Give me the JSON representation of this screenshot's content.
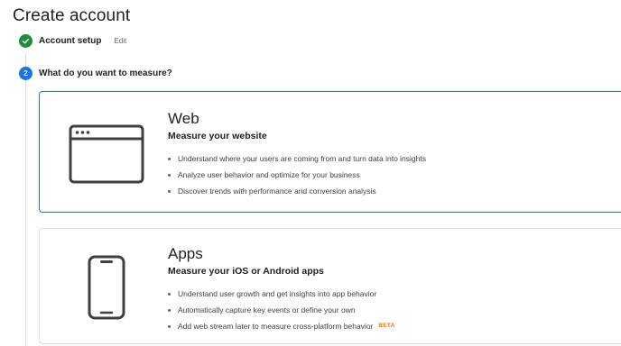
{
  "page": {
    "title": "Create account"
  },
  "stepper": {
    "steps": [
      {
        "label": "Account setup",
        "action": "Edit",
        "status": "completed",
        "icon": "check-icon"
      },
      {
        "number": "2",
        "label": "What do you want to measure?",
        "status": "active"
      }
    ]
  },
  "options": [
    {
      "title": "Web",
      "subtitle": "Measure your website",
      "icon": "browser-window-icon",
      "selected": true,
      "bullets": [
        "Understand where your users are coming from and turn data into insights",
        "Analyze user behavior and optimize for your business",
        "Discover trends with performance and conversion analysis"
      ]
    },
    {
      "title": "Apps",
      "subtitle": "Measure your iOS or Android apps",
      "icon": "mobile-phone-icon",
      "selected": false,
      "bullets": [
        "Understand user growth and get insights into app behavior",
        "Automatically capture key events or define your own",
        "Add web stream later to measure cross-platform behavior"
      ],
      "badge": "BETA"
    }
  ],
  "colors": {
    "accent": "#1a73e8",
    "success": "#1e8e3e",
    "beta": "#e37400",
    "border": "#dadce0"
  }
}
